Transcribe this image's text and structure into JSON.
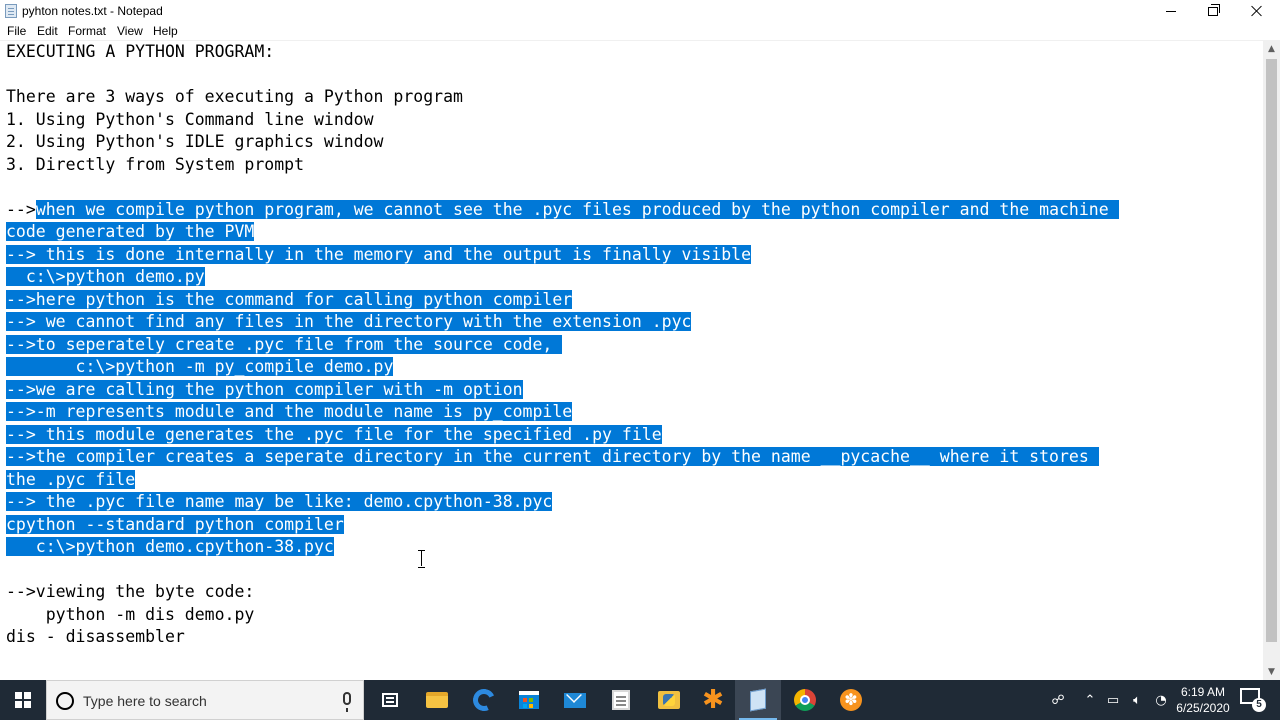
{
  "window": {
    "title": "pyhton notes.txt - Notepad"
  },
  "menu": [
    "File",
    "Edit",
    "Format",
    "View",
    "Help"
  ],
  "editor": {
    "lines": [
      {
        "pre": "EXECUTING A PYTHON PROGRAM:",
        "sel": ""
      },
      {
        "pre": "",
        "sel": ""
      },
      {
        "pre": "There are 3 ways of executing a Python program",
        "sel": ""
      },
      {
        "pre": "1. Using Python's Command line window",
        "sel": ""
      },
      {
        "pre": "2. Using Python's IDLE graphics window",
        "sel": ""
      },
      {
        "pre": "3. Directly from System prompt",
        "sel": ""
      },
      {
        "pre": "",
        "sel": ""
      },
      {
        "pre": "-->",
        "sel": "when we compile python program, we cannot see the .pyc files produced by the python compiler and the machine "
      },
      {
        "pre": "",
        "sel": "code generated by the PVM"
      },
      {
        "pre": "",
        "sel": "--> this is done internally in the memory and the output is finally visible"
      },
      {
        "pre": "",
        "sel": "  c:\\>python demo.py"
      },
      {
        "pre": "",
        "sel": "-->here python is the command for calling python compiler"
      },
      {
        "pre": "",
        "sel": "--> we cannot find any files in the directory with the extension .pyc"
      },
      {
        "pre": "",
        "sel": "-->to seperately create .pyc file from the source code, "
      },
      {
        "pre": "",
        "sel": "       c:\\>python -m py_compile demo.py"
      },
      {
        "pre": "",
        "sel": "-->we are calling the python compiler with -m option"
      },
      {
        "pre": "",
        "sel": "-->-m represents module and the module name is py_compile"
      },
      {
        "pre": "",
        "sel": "--> this module generates the .pyc file for the specified .py file"
      },
      {
        "pre": "",
        "sel": "-->the compiler creates a seperate directory in the current directory by the name __pycache__ where it stores "
      },
      {
        "pre": "",
        "sel": "the .pyc file"
      },
      {
        "pre": "",
        "sel": "--> the .pyc file name may be like: demo.cpython-38.pyc"
      },
      {
        "pre": "",
        "sel": "cpython --standard python compiler"
      },
      {
        "pre": "",
        "sel": "   c:\\>python demo.cpython-38.pyc"
      },
      {
        "pre": "",
        "sel": ""
      },
      {
        "pre": "-->viewing the byte code:",
        "sel": ""
      },
      {
        "pre": "    python -m dis demo.py",
        "sel": ""
      },
      {
        "pre": "dis - disassembler",
        "sel": ""
      }
    ]
  },
  "taskbar": {
    "search_placeholder": "Type here to search",
    "time": "6:19 AM",
    "date": "6/25/2020",
    "notification_count": "5"
  },
  "colors": {
    "selection": "#0078d7",
    "taskbar": "#1f2a36"
  }
}
